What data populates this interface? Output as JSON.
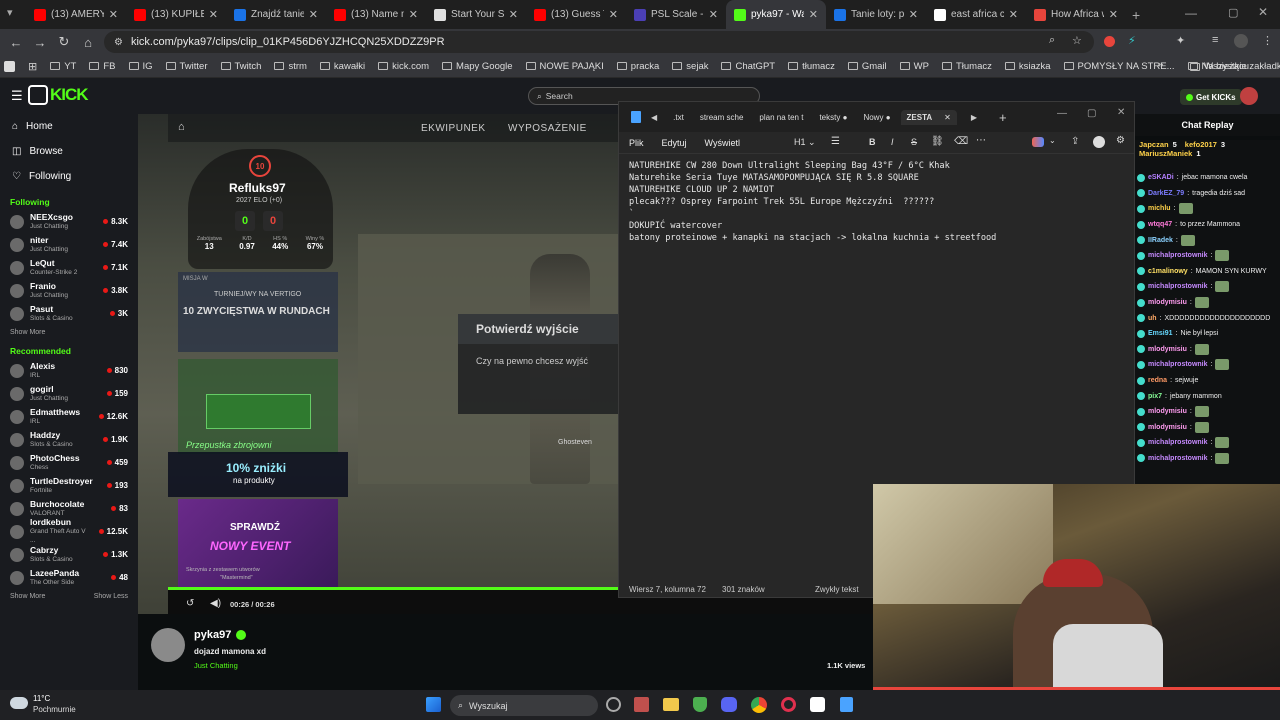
{
  "tabs": [
    {
      "title": "(13) AMERYKA",
      "color": "#ff0000"
    },
    {
      "title": "(13) KUPIŁEM",
      "color": "#ff0000"
    },
    {
      "title": "Znajdź tanie lo",
      "color": "#1a73e8"
    },
    {
      "title": "(13) Name me",
      "color": "#ff0000"
    },
    {
      "title": "Start Your Sca",
      "color": "#e0e0e0"
    },
    {
      "title": "(13) Guess THE",
      "color": "#ff0000"
    },
    {
      "title": "PSL Scale - AI-",
      "color": "#4b3fb5"
    },
    {
      "title": "pyka97 - Watc",
      "color": "#53fc18",
      "active": true
    },
    {
      "title": "Tanie loty: por",
      "color": "#1a73e8"
    },
    {
      "title": "east africa cou",
      "color": "#ffffff"
    },
    {
      "title": "How Africa wo",
      "color": "#e8453c"
    }
  ],
  "address": {
    "url": "kick.com/pyka97/clips/clip_01KP456D6YJZHCQN25XDDZZ9PR"
  },
  "bookmarks": [
    "YT",
    "FB",
    "IG",
    "Twitter",
    "Twitch",
    "strm",
    "kawałki",
    "kick.com",
    "Mapy Google",
    "NOWE PAJĄKI",
    "pracka",
    "sejak",
    "ChatGPT",
    "tłumacz",
    "Gmail",
    "WP",
    "Tłumacz",
    "ksiazka",
    "POMYSŁY NA STRE...",
    "Na bieżącu"
  ],
  "bookmarks_right": "Wszystkie zakładki",
  "kick": {
    "search_placeholder": "Search",
    "get_kicks": "Get KICKs",
    "nav": [
      "Home",
      "Browse",
      "Following"
    ],
    "following_title": "Following",
    "following": [
      {
        "name": "NEEXcsgo",
        "cat": "Just Chatting",
        "viewers": "8.3K"
      },
      {
        "name": "niter",
        "cat": "Just Chatting",
        "viewers": "7.4K"
      },
      {
        "name": "LeQut",
        "cat": "Counter-Strike 2",
        "viewers": "7.1K"
      },
      {
        "name": "Franio",
        "cat": "Just Chatting",
        "viewers": "3.8K"
      },
      {
        "name": "Pasut",
        "cat": "Slots & Casino",
        "viewers": "3K"
      }
    ],
    "show_more": "Show More",
    "show_less": "Show Less",
    "recommended_title": "Recommended",
    "recommended": [
      {
        "name": "Alexis",
        "cat": "IRL",
        "viewers": "830"
      },
      {
        "name": "gogirl",
        "cat": "Just Chatting",
        "viewers": "159"
      },
      {
        "name": "Edmatthews",
        "cat": "IRL",
        "viewers": "12.6K"
      },
      {
        "name": "Haddzy",
        "cat": "Slots & Casino",
        "viewers": "1.9K"
      },
      {
        "name": "PhotoChess",
        "cat": "Chess",
        "viewers": "459"
      },
      {
        "name": "TurtleDestroyer",
        "cat": "Fortnite",
        "viewers": "193"
      },
      {
        "name": "Burchocolate",
        "cat": "VALORANT",
        "viewers": "83"
      },
      {
        "name": "lordkebun",
        "cat": "Grand Theft Auto V ...",
        "viewers": "12.5K"
      },
      {
        "name": "Cabrzy",
        "cat": "Slots & Casino",
        "viewers": "1.3K"
      },
      {
        "name": "LazeePanda",
        "cat": "The Other Side",
        "viewers": "48"
      }
    ],
    "streamer": "pyka97",
    "clip_title": "dojazd mamona xd",
    "category": "Just Chatting",
    "views": "1.1K views",
    "time": "00:26 / 00:26",
    "chat_title": "Chat Replay"
  },
  "game": {
    "menu": [
      "EKWIPUNEK",
      "WYPOSAŻENIE"
    ],
    "player": "Refluks97",
    "elo": "2027 ELO (+0)",
    "level": "10",
    "wins_score": "0",
    "losses_score": "0",
    "stats_labels": [
      "Zabójstwa",
      "K/D",
      "HS %",
      "Winy %"
    ],
    "stats_values": [
      "13",
      "0.97",
      "44%",
      "67%"
    ],
    "mission_label": "MISJA W",
    "tournament": "TURNIEJ/WY NA VERTIGO",
    "mission": "10 ZWYCIĘSTWA W RUNDACH",
    "pass": "Przepustka zbrojowni",
    "discount": "10% zniżki",
    "discount_sub": "na produkty",
    "check": "SPRAWDŹ",
    "event": "NOWY EVENT",
    "event_sub": "Skrzynia z zestawem utworów",
    "event_sub2": "\"Mastermind\"",
    "dialog_title": "Potwierdź wyjście",
    "dialog_text": "Czy na pewno chcesz wyjść",
    "enemy_name": "Ghosteven"
  },
  "notepad": {
    "tabs": [
      ".txt",
      "stream sche",
      "plan na ten t",
      "teksty",
      "Nowy",
      "ZESTA"
    ],
    "menu": [
      "Plik",
      "Edytuj",
      "Wyświetl"
    ],
    "heading": "H1",
    "lines": [
      "NATUREHIKE CW 280 Down Ultralight Sleeping Bag 43°F / 6°C Khak",
      "Naturehike Seria Tuye MATASAMOPOMPUJĄCA SIĘ R 5.8 SQUARE",
      "NATUREHIKE CLOUD UP 2 NAMIOT",
      "plecak??? Osprey Farpoint Trek 55L Europe Mężczyźni  ??????",
      "`",
      "DOKUPIĆ watercover",
      "batony proteinowe + kanapki na stacjach -> lokalna kuchnia + streetfood"
    ],
    "status": [
      "Wiersz 7, kolumna 72",
      "301 znaków",
      "Zwykły tekst"
    ]
  },
  "chat": {
    "top": [
      {
        "name": "Japczan",
        "n": "5"
      },
      {
        "name": "kefo2017",
        "n": "3"
      },
      {
        "name": "MariuszManiek",
        "n": "1"
      }
    ],
    "messages": [
      {
        "user": "eSKADi",
        "text": "jebac mamona cwela",
        "color": "#b480ff"
      },
      {
        "user": "DarkEZ_79",
        "text": "tragedia dziś sad",
        "color": "#7c7cff"
      },
      {
        "user": "michlu",
        "text": "",
        "color": "#ffd24a"
      },
      {
        "user": "wtqq47",
        "text": "to przez Mammona",
        "color": "#ff7ad9"
      },
      {
        "user": "IIRadek",
        "text": "",
        "color": "#8ad1ff"
      },
      {
        "user": "michalprostownik",
        "text": "",
        "color": "#c68aff"
      },
      {
        "user": "c1malinowy",
        "text": "MAMON SYN KURWY",
        "color": "#ffe066"
      },
      {
        "user": "michalprostownik",
        "text": "",
        "color": "#c68aff"
      },
      {
        "user": "mlodymisiu",
        "text": "",
        "color": "#ff9cf0"
      },
      {
        "user": "uh",
        "text": "XDDDDDDDDDDDDDDDDDDDD",
        "color": "#ffaa66"
      },
      {
        "user": "Emsi91",
        "text": "Nie był lepsi",
        "color": "#66d9ff"
      },
      {
        "user": "mlodymisiu",
        "text": "",
        "color": "#ff9cf0"
      },
      {
        "user": "michalprostownik",
        "text": "",
        "color": "#c68aff"
      },
      {
        "user": "redna",
        "text": "sejwuje",
        "color": "#ff9a66"
      },
      {
        "user": "pix7",
        "text": "jebany mammon",
        "color": "#88ff99"
      },
      {
        "user": "mlodymisiu",
        "text": "",
        "color": "#ff9cf0"
      },
      {
        "user": "mlodymisiu",
        "text": "",
        "color": "#ff9cf0"
      },
      {
        "user": "michalprostownik",
        "text": "",
        "color": "#c68aff"
      },
      {
        "user": "michalprostownik",
        "text": "",
        "color": "#c68aff"
      }
    ]
  },
  "taskbar": {
    "weather_temp": "11°C",
    "weather_desc": "Pochmurnie",
    "search": "Wyszukaj"
  }
}
